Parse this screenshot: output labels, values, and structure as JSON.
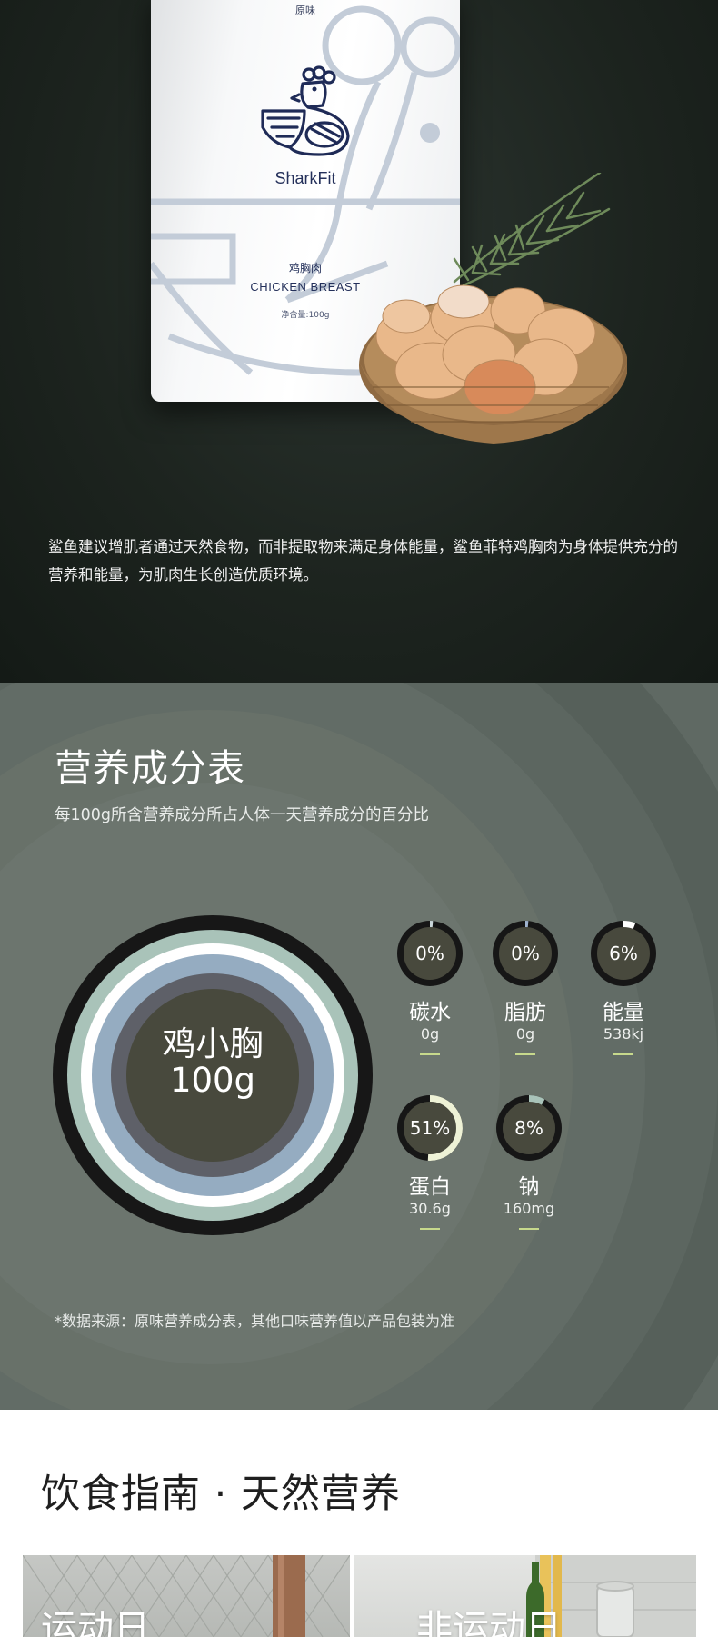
{
  "product": {
    "flavor": "原味",
    "brand": "SharkFit",
    "name_cn": "鸡胸肉",
    "name_en": "CHICKEN BREAST",
    "net_weight": "净含量:100g"
  },
  "hero": {
    "description": "鲨鱼建议增肌者通过天然食物，而非提取物来满足身体能量，鲨鱼菲特鸡胸肉为身体提供充分的营养和能量，为肌肉生长创造优质环境。"
  },
  "nutrition": {
    "title": "营养成分表",
    "subtitle": "每100g所含营养成分所占人体一天营养成分的百分比",
    "center_label_line1": "鸡小胸",
    "center_label_line2": "100g",
    "items": [
      {
        "name": "碳水",
        "amount": "0g",
        "percent_label": "0%",
        "percent": 0,
        "ring_color": "#c9d6da"
      },
      {
        "name": "脂肪",
        "amount": "0g",
        "percent_label": "0%",
        "percent": 0,
        "ring_color": "#9fb3cf"
      },
      {
        "name": "能量",
        "amount": "538kj",
        "percent_label": "6%",
        "percent": 6,
        "ring_color": "#ffffff"
      },
      {
        "name": "蛋白",
        "amount": "30.6g",
        "percent_label": "51%",
        "percent": 51,
        "ring_color": "#eef2d6"
      },
      {
        "name": "钠",
        "amount": "160mg",
        "percent_label": "8%",
        "percent": 8,
        "ring_color": "#a9c3b9"
      }
    ],
    "source_note": "*数据来源：原味营养成分表，其他口味营养值以产品包装为准"
  },
  "guide": {
    "title": "饮食指南 · 天然营养",
    "cards": [
      {
        "label": "运动日"
      },
      {
        "label": "非运动日"
      }
    ]
  },
  "colors": {
    "hero_bg": "#1d241f",
    "nutrition_bg": "#5f6963",
    "dial_fill": "#48493d",
    "accent_dash": "#c7d98c",
    "brand_navy": "#24305a"
  }
}
